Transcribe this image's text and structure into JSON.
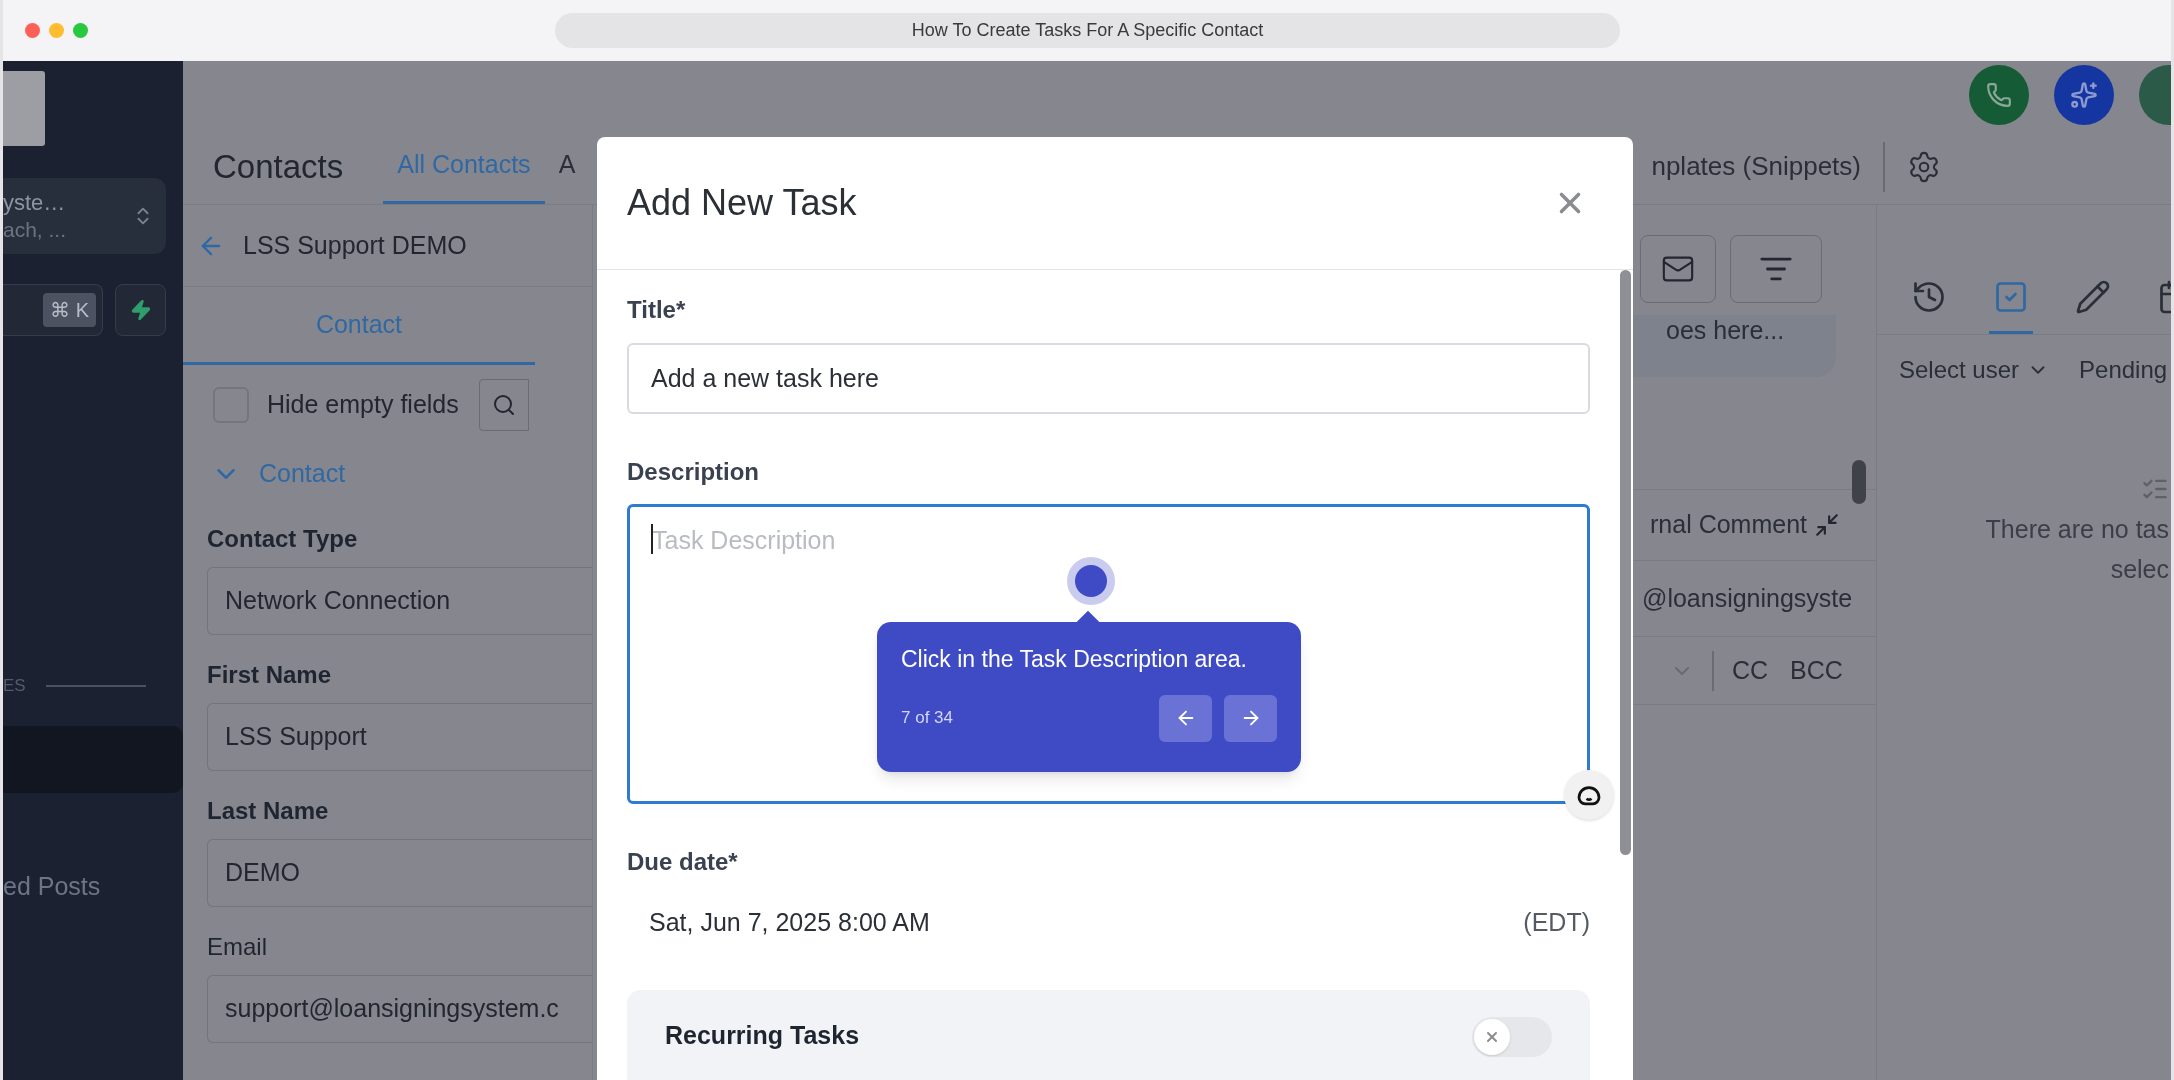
{
  "browser": {
    "title": "How To Create Tasks For A Specific Contact"
  },
  "sidebar": {
    "workspace": {
      "name": "yste…",
      "subtitle": "ach, ..."
    },
    "search_shortcut": "⌘ K",
    "section_label": "ES",
    "items": [
      {
        "selected": true
      },
      {
        "label": "ed Posts",
        "selected": false
      }
    ]
  },
  "header": {
    "title": "Contacts",
    "tabs": [
      {
        "label": "All Contacts",
        "selected": true
      },
      {
        "label": "A",
        "selected": false
      }
    ],
    "templates_link": "nplates (Snippets)"
  },
  "contact_panel": {
    "back_title": "LSS Support DEMO",
    "tabs": [
      {
        "label": "Contact",
        "selected": true
      }
    ],
    "hide_empty": {
      "label": "Hide empty fields",
      "checked": false
    },
    "section": {
      "title": "Contact",
      "expanded": true
    },
    "fields": [
      {
        "label": "Contact Type",
        "value": "Network Connection"
      },
      {
        "label": "First Name",
        "value": "LSS Support"
      },
      {
        "label": "Last Name",
        "value": "DEMO"
      },
      {
        "label": "Email",
        "value": "support@loansigningsystem.c"
      }
    ]
  },
  "middle": {
    "note_snippet": "oes here...",
    "comment_title": "rnal Comment",
    "email_to": "@loansigningsyste",
    "cc": "CC",
    "bcc": "BCC"
  },
  "right_panel": {
    "tabs": [
      {
        "kind": "history",
        "selected": false
      },
      {
        "kind": "tasks",
        "selected": true
      },
      {
        "kind": "notes",
        "selected": false
      },
      {
        "kind": "calendar",
        "selected": false
      }
    ],
    "filters": [
      "Select user",
      "Pending"
    ],
    "empty_lines": [
      "There are no tas",
      "selec"
    ]
  },
  "modal": {
    "title": "Add New Task",
    "title_field": {
      "label": "Title*",
      "value": "Add a new task here"
    },
    "description": {
      "label": "Description",
      "placeholder": "Task Description"
    },
    "due": {
      "label": "Due date*",
      "value": "Sat, Jun 7, 2025 8:00 AM",
      "zone": "(EDT)"
    },
    "recurring": {
      "label": "Recurring Tasks",
      "on": false
    }
  },
  "tour": {
    "text": "Click in the Task Description area.",
    "progress": "7 of 34"
  }
}
